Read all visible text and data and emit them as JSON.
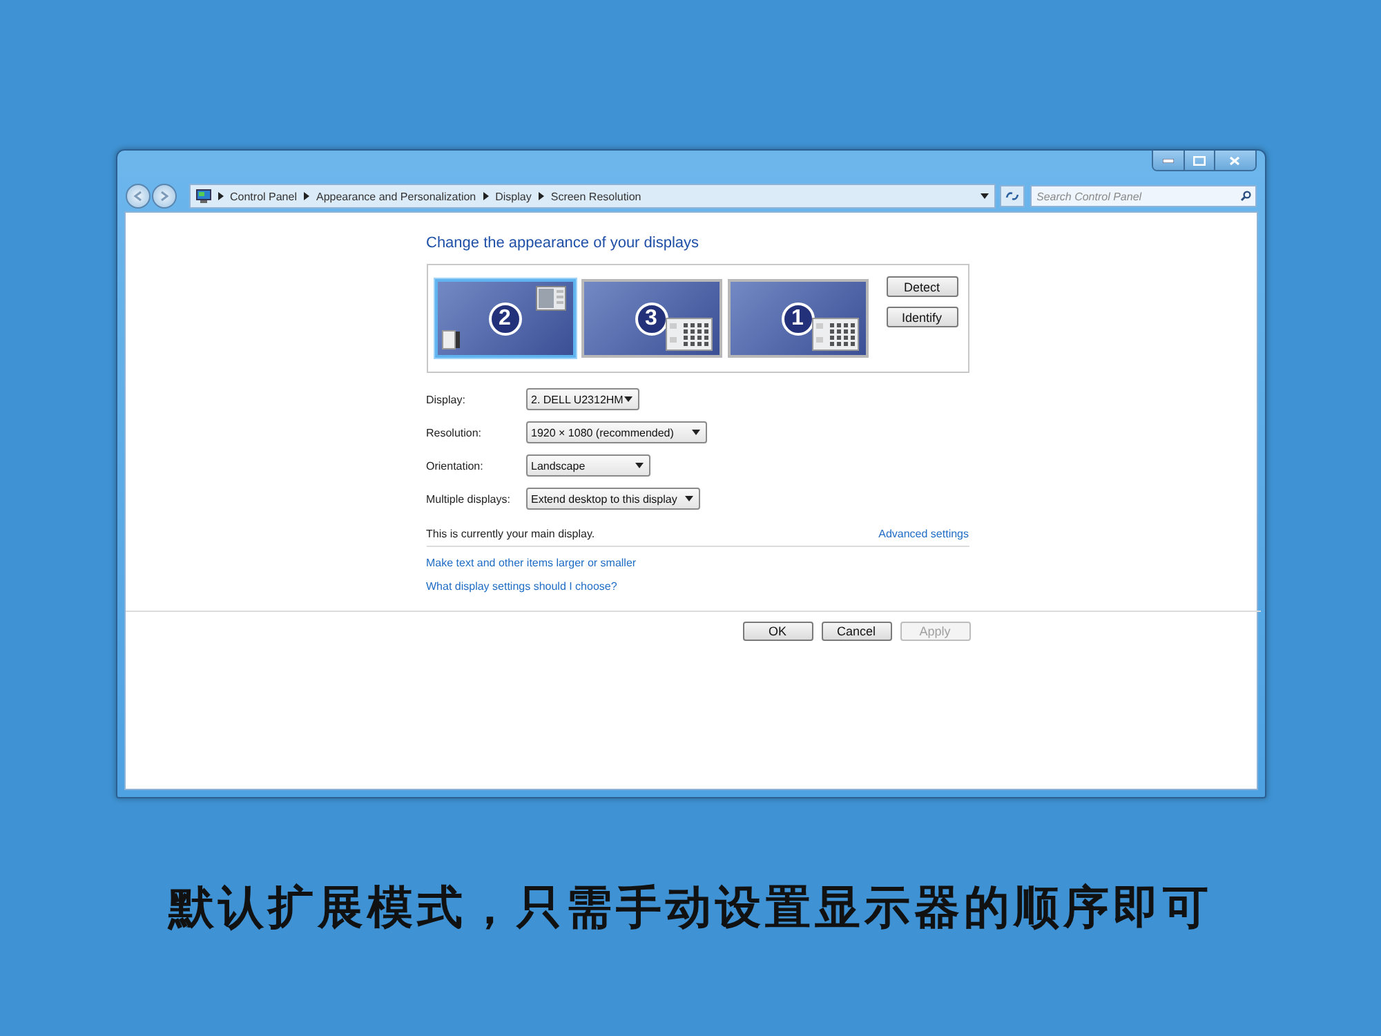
{
  "breadcrumb": [
    "Control Panel",
    "Appearance and Personalization",
    "Display",
    "Screen Resolution"
  ],
  "search": {
    "placeholder": "Search Control Panel"
  },
  "heading": "Change the appearance of your displays",
  "monitors": [
    {
      "label": "2",
      "selected": true
    },
    {
      "label": "3",
      "selected": false
    },
    {
      "label": "1",
      "selected": false
    }
  ],
  "preview_buttons": [
    "Detect",
    "Identify"
  ],
  "settings": [
    {
      "label": "Display:",
      "value": "2. DELL U2312HM"
    },
    {
      "label": "Resolution:",
      "value": "1920 × 1080 (recommended)"
    },
    {
      "label": "Orientation:",
      "value": "Landscape"
    },
    {
      "label": "Multiple displays:",
      "value": "Extend desktop to this display"
    }
  ],
  "main_display_note": "This is currently your main display.",
  "advanced_link": "Advanced settings",
  "links": [
    "Make text and other items larger or smaller",
    "What display settings should I choose?"
  ],
  "buttons": [
    {
      "label": "OK",
      "disabled": false
    },
    {
      "label": "Cancel",
      "disabled": false
    },
    {
      "label": "Apply",
      "disabled": true
    }
  ],
  "caption": "默认扩展模式，只需手动设置显示器的顺序即可"
}
